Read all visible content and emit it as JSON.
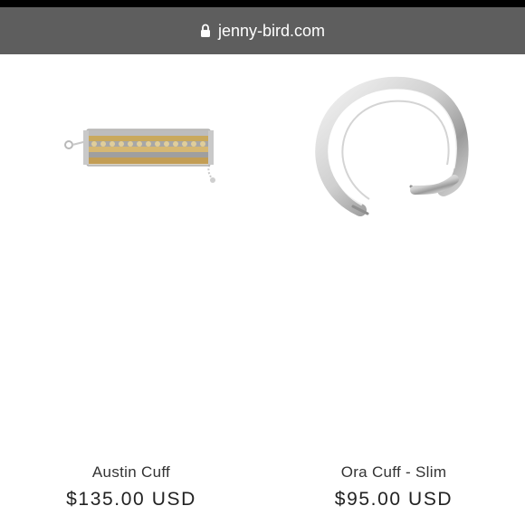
{
  "browser": {
    "url": "jenny-bird.com",
    "icon": "lock-icon"
  },
  "products": [
    {
      "name": "Austin Cuff",
      "price": "$135.00 USD",
      "image": "multi-chain-bracelet-gold-silver"
    },
    {
      "name": "Ora Cuff - Slim",
      "price": "$95.00 USD",
      "image": "silver-open-cuff-bangle"
    }
  ],
  "colors": {
    "urlbar": "#5e5e5e",
    "statusbar": "#000000",
    "background": "#ffffff",
    "text": "#222222"
  }
}
